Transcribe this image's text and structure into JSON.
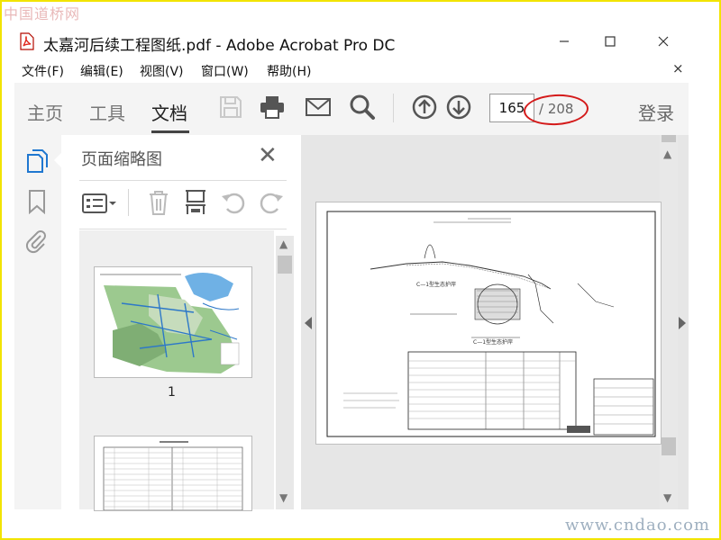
{
  "watermark": {
    "top": "中国道桥网",
    "bottom": "www.cndao.com"
  },
  "window": {
    "title": "太嘉河后续工程图纸.pdf - Adobe Acrobat Pro DC",
    "icon": "pdf-file-icon",
    "controls": [
      "minimize",
      "maximize",
      "close"
    ]
  },
  "menu": {
    "items": [
      "文件(F)",
      "编辑(E)",
      "视图(V)",
      "窗口(W)",
      "帮助(H)"
    ],
    "close_glyph": "×"
  },
  "toolbar": {
    "tabs": [
      {
        "label": "主页"
      },
      {
        "label": "工具"
      },
      {
        "label": "文档",
        "active": true
      }
    ],
    "icons": [
      "save-icon",
      "print-icon",
      "email-icon",
      "search-icon",
      "prev-page-icon",
      "next-page-icon"
    ],
    "page_current": "165",
    "page_total": "/ 208",
    "login": "登录",
    "highlight_color": "#d41a1a"
  },
  "sidebar": {
    "icons": [
      "page-thumbnails-icon",
      "bookmark-icon",
      "attachment-icon"
    ]
  },
  "thumbnail_panel": {
    "title": "页面缩略图",
    "close_glyph": "✕",
    "tools": [
      "thumbnail-options-icon",
      "delete-page-icon",
      "crop-page-icon",
      "rotate-left-icon",
      "rotate-right-icon"
    ],
    "thumbnails": [
      {
        "label": "1"
      },
      {
        "label": ""
      }
    ]
  },
  "document": {
    "table_title": "C—1型生态护岸",
    "profile_title": "C—1型生态护岸"
  }
}
